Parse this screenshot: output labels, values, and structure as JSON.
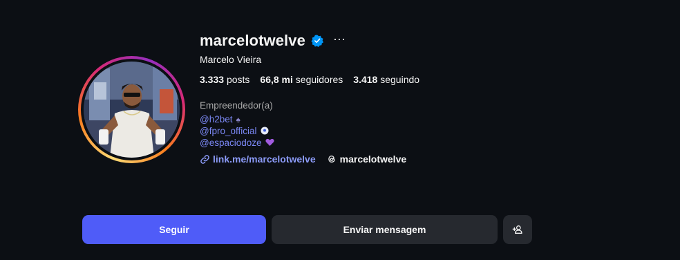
{
  "profile": {
    "username": "marcelotwelve",
    "full_name": "Marcelo Vieira",
    "more_icon": "more-icon",
    "verified_icon": "verified-badge-icon"
  },
  "stats": {
    "posts_value": "3.333",
    "posts_label": "posts",
    "followers_value": "66,8 mi",
    "followers_label": "seguidores",
    "following_value": "3.418",
    "following_label": "seguindo"
  },
  "bio": {
    "category": "Empreendedor(a)",
    "lines": [
      {
        "text": "@h2bet",
        "emoji": "♠"
      },
      {
        "text": "@fpro_official",
        "emoji": "⚽"
      },
      {
        "text": "@espaciodoze",
        "emoji": "💜"
      }
    ]
  },
  "links": {
    "website": "link.me/marcelotwelve",
    "threads_handle": "marcelotwelve"
  },
  "actions": {
    "follow_label": "Seguir",
    "message_label": "Enviar mensagem",
    "suggest_icon": "add-person-icon"
  },
  "colors": {
    "background": "#0c0f14",
    "primary_button": "#4f5cf8",
    "secondary_button": "#26292f",
    "link": "#7b88f5",
    "verified": "#0095f6"
  }
}
